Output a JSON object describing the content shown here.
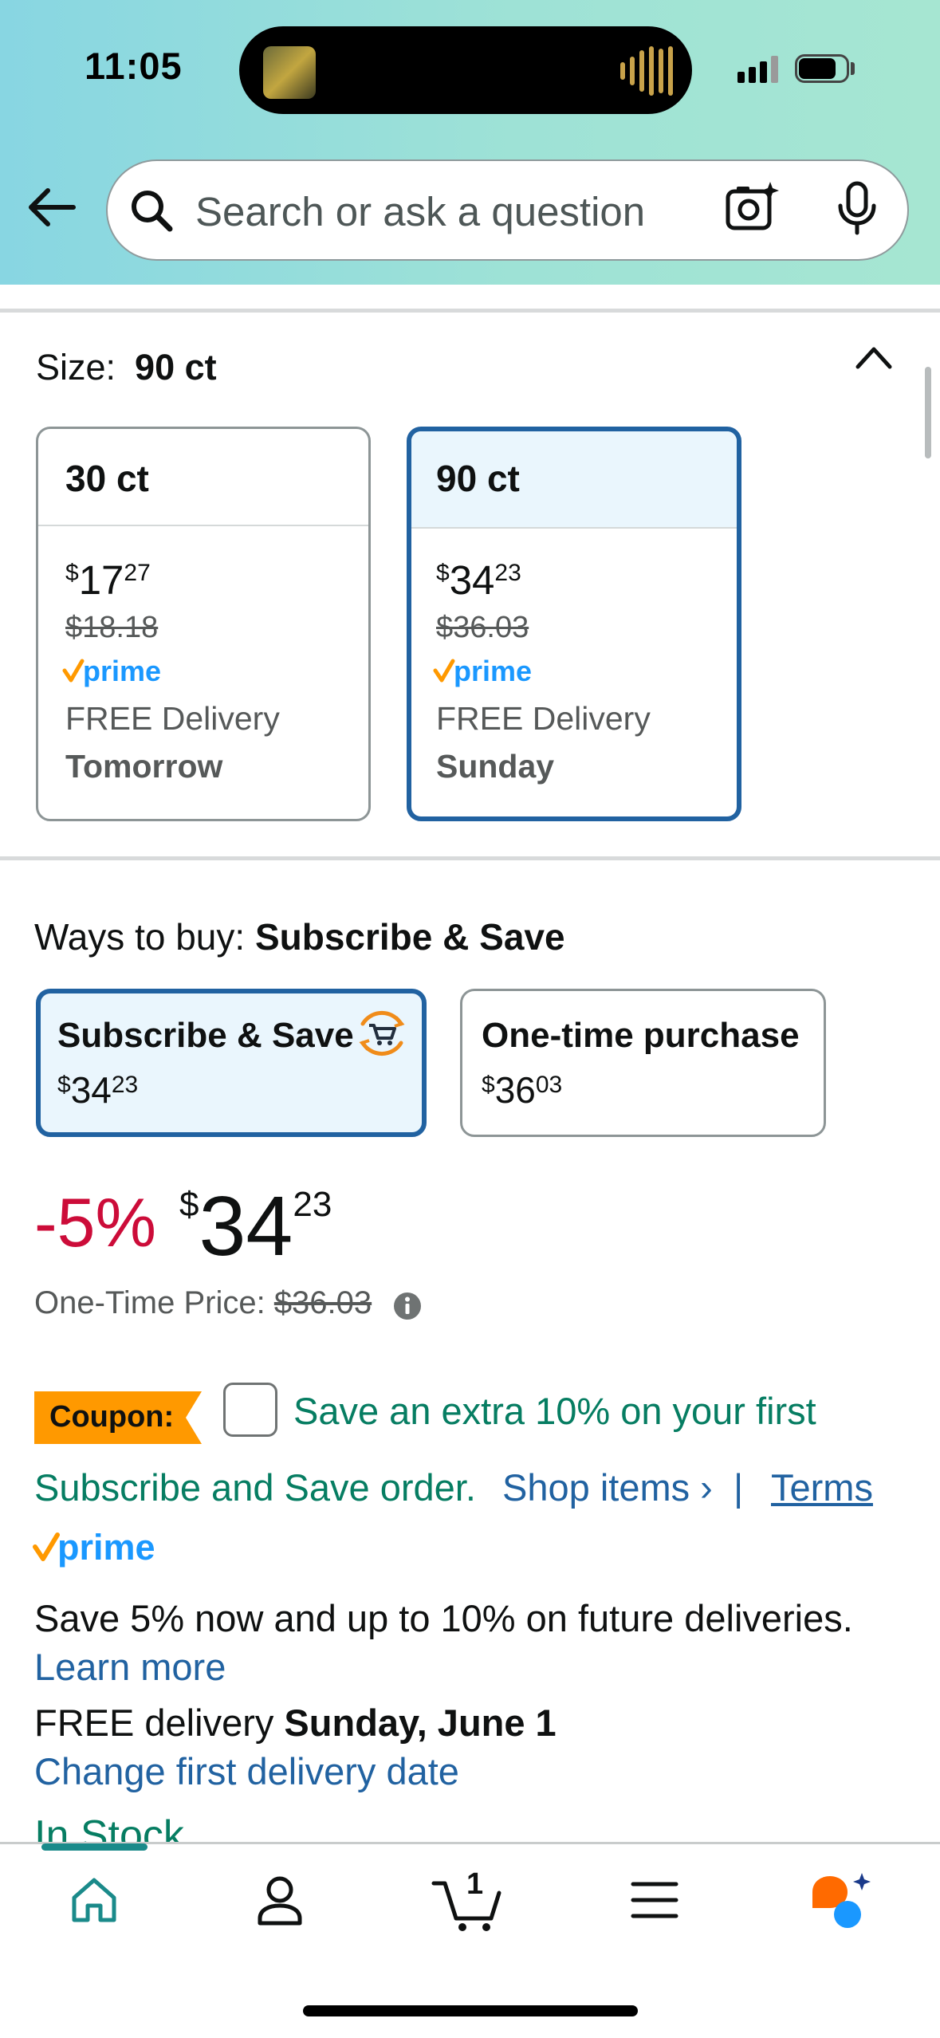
{
  "status_bar": {
    "time": "11:05"
  },
  "search": {
    "placeholder": "Search or ask a question"
  },
  "size": {
    "label": "Size:",
    "selected": "90 ct",
    "options": [
      {
        "name": "30 ct",
        "price_whole": "17",
        "price_fraction": "27",
        "currency": "$",
        "list_price": "$18.18",
        "prime": "prime",
        "delivery": "FREE Delivery",
        "day": "Tomorrow",
        "selected": false
      },
      {
        "name": "90 ct",
        "price_whole": "34",
        "price_fraction": "23",
        "currency": "$",
        "list_price": "$36.03",
        "prime": "prime",
        "delivery": "FREE Delivery",
        "day": "Sunday",
        "selected": true
      }
    ]
  },
  "ways_to_buy": {
    "label": "Ways to buy:",
    "selected": "Subscribe & Save",
    "options": [
      {
        "title": "Subscribe & Save",
        "currency": "$",
        "price_whole": "34",
        "price_fraction": "23"
      },
      {
        "title": "One-time purchase",
        "currency": "$",
        "price_whole": "36",
        "price_fraction": "03"
      }
    ]
  },
  "price": {
    "discount": "-5%",
    "currency": "$",
    "whole": "34",
    "fraction": "23",
    "one_time_label": "One-Time Price:",
    "one_time_value": "$36.03"
  },
  "coupon": {
    "badge": "Coupon:",
    "line1": "Save an extra 10% on your first",
    "line2": "Subscribe and Save order.",
    "shop_items": "Shop items ›",
    "separator": "|",
    "terms": "Terms"
  },
  "prime_label": "prime",
  "subscribe_note": "Save 5% now and up to 10% on future deliveries.",
  "learn_more": "Learn more",
  "delivery": {
    "prefix": "FREE delivery",
    "date": "Sunday, June 1",
    "change": "Change first delivery date"
  },
  "stock": "In Stock",
  "nav": {
    "cart_count": "1"
  },
  "colors": {
    "link": "#2162a1",
    "deal_red": "#cc0c39",
    "green": "#067d62",
    "selected_border": "#2162a1",
    "coupon_orange": "#ff9900",
    "header_teal": "#88d6e2"
  }
}
